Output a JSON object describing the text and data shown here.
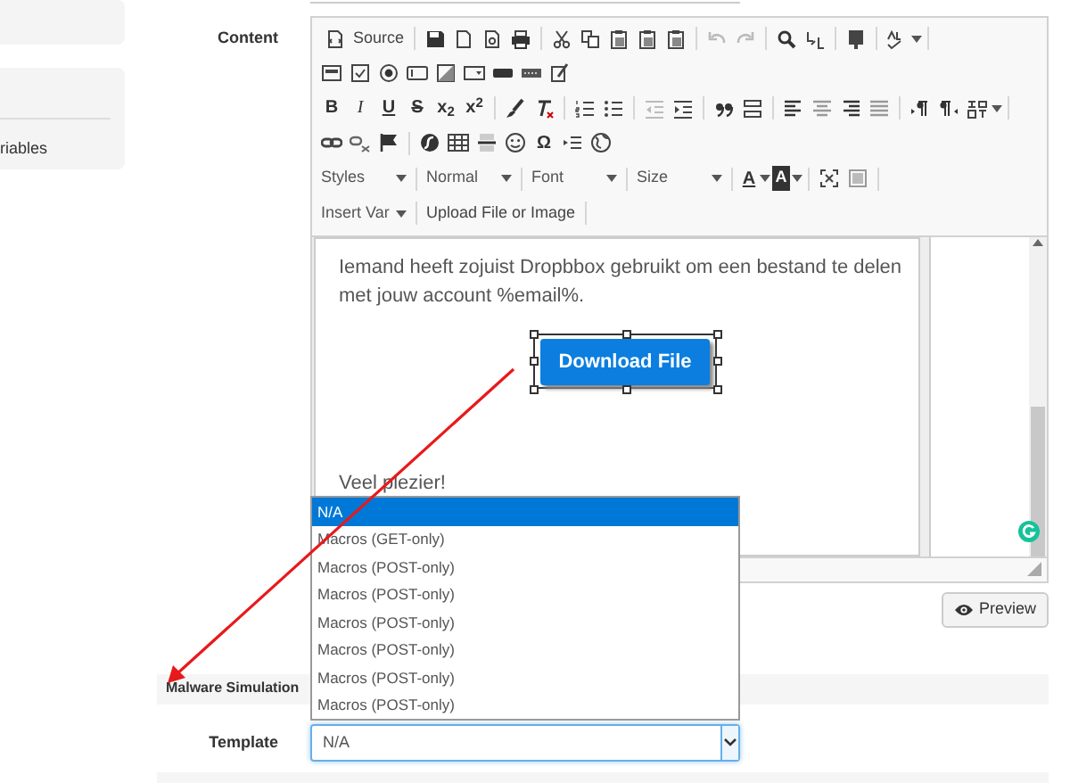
{
  "sidebar": {
    "items": [
      {
        "label": "riables"
      }
    ]
  },
  "content_field": {
    "label": "Content",
    "toolbar": {
      "source": "Source",
      "bold": "B",
      "italic": "I",
      "underline": "U",
      "strike": "S",
      "sub": "x$_{2}$",
      "sup": "x$^{2}$",
      "omega": "Ω",
      "styles": "Styles",
      "format": "Normal",
      "font": "Font",
      "size": "Size",
      "font_color": "A",
      "bg_color": "A",
      "insert_var": "Insert Var",
      "upload": "Upload File or Image"
    },
    "body": {
      "paragraph": "Iemand heeft zojuist Dropbbox gebruikt om een bestand te delen met jouw account %email%.",
      "button": {
        "text": "Download File",
        "selected": true
      },
      "closing": "Veel plezier!"
    },
    "preview_button": "Preview"
  },
  "malware_section": {
    "title": "Malware Simulation",
    "template_label": "Template",
    "template_value": "N/A",
    "options": [
      {
        "label": "N/A",
        "selected": true
      },
      {
        "label": "Macros (GET-only)",
        "selected": false
      },
      {
        "label": "Macros (POST-only)",
        "selected": false
      },
      {
        "label": "Macros (POST-only)",
        "selected": false
      },
      {
        "label": "Macros (POST-only)",
        "selected": false
      },
      {
        "label": "Macros (POST-only)",
        "selected": false
      },
      {
        "label": "Macros (POST-only)",
        "selected": false
      },
      {
        "label": "Macros (POST-only)",
        "selected": false
      }
    ]
  }
}
